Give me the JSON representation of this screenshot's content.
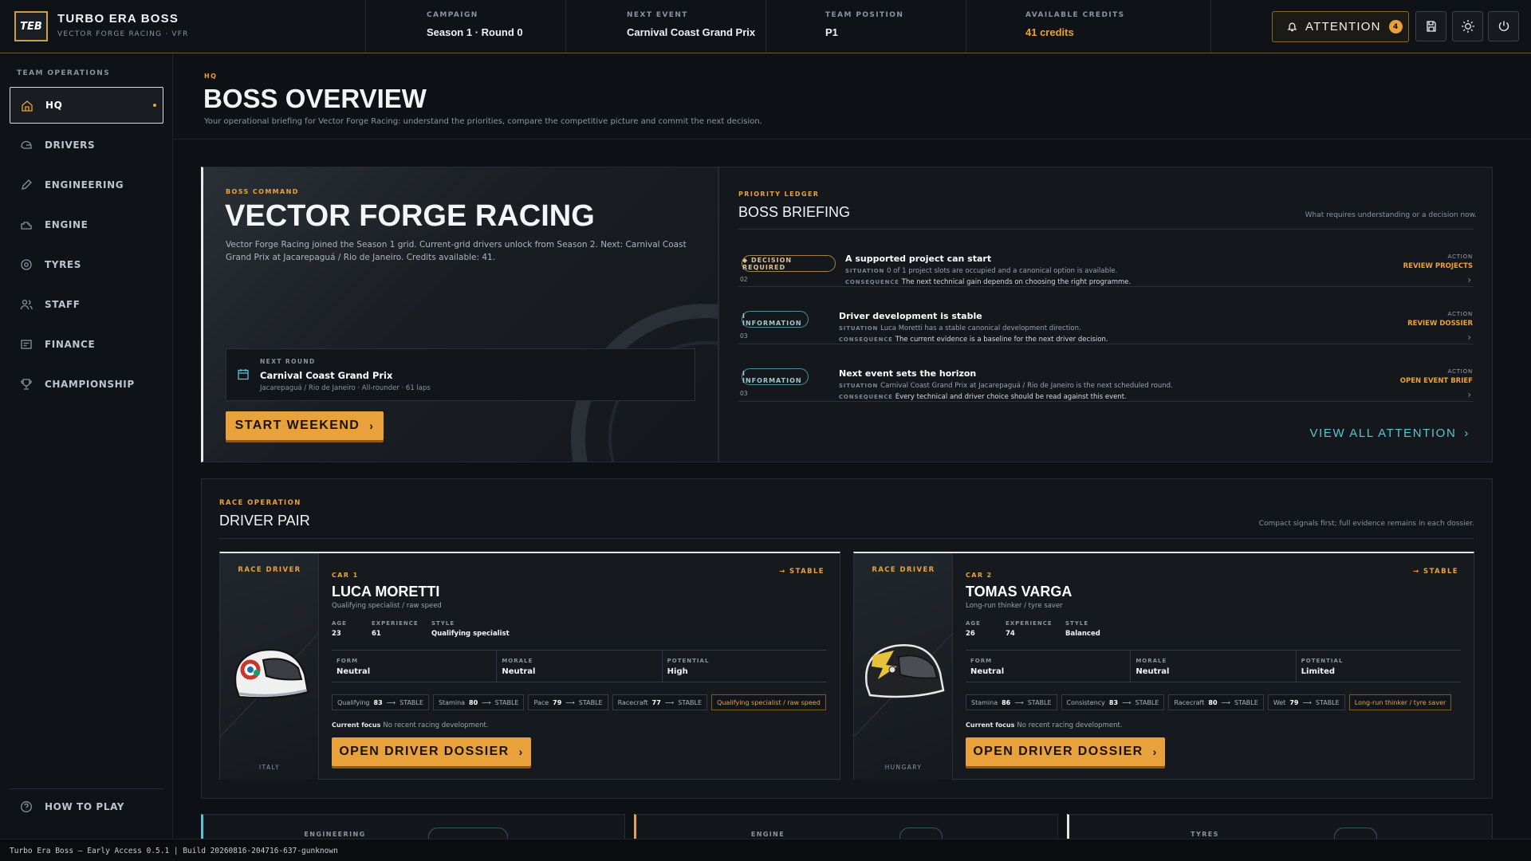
{
  "app": {
    "logo": "TEB",
    "title": "TURBO ERA BOSS",
    "subtitle": "VECTOR FORGE RACING · VFR"
  },
  "header": {
    "stats": [
      {
        "label": "CAMPAIGN",
        "value": "Season 1 · Round 0"
      },
      {
        "label": "NEXT EVENT",
        "value": "Carnival Coast Grand Prix"
      },
      {
        "label": "TEAM POSITION",
        "value": "P1"
      },
      {
        "label": "AVAILABLE CREDITS",
        "value": "41 credits"
      }
    ],
    "attention_label": "ATTENTION",
    "attention_count": "4"
  },
  "sidebar": {
    "section": "TEAM OPERATIONS",
    "items": [
      {
        "label": "HQ"
      },
      {
        "label": "DRIVERS"
      },
      {
        "label": "ENGINEERING"
      },
      {
        "label": "ENGINE"
      },
      {
        "label": "TYRES"
      },
      {
        "label": "STAFF"
      },
      {
        "label": "FINANCE"
      },
      {
        "label": "CHAMPIONSHIP"
      }
    ],
    "help": "HOW TO PLAY"
  },
  "page": {
    "kicker": "HQ",
    "title": "BOSS OVERVIEW",
    "subtitle": "Your operational briefing for Vector Forge Racing: understand the priorities, compare the competitive picture and commit the next decision."
  },
  "command": {
    "kicker": "BOSS COMMAND",
    "title": "VECTOR FORGE RACING",
    "desc": "Vector Forge Racing joined the Season 1 grid. Current-grid drivers unlock from Season 2. Next: Carnival Coast Grand Prix at Jacarepaguá / Rio de Janeiro. Credits available: 41.",
    "next_label": "NEXT ROUND",
    "next_title": "Carnival Coast Grand Prix",
    "next_sub": "Jacarepaguá / Rio de Janeiro · All-rounder · 61 laps",
    "start": "START WEEKEND"
  },
  "briefing": {
    "kicker": "PRIORITY LEDGER",
    "title": "BOSS BRIEFING",
    "note": "What requires understanding or a decision now.",
    "situation_label": "SITUATION",
    "consequence_label": "CONSEQUENCE",
    "action_label": "ACTION",
    "view_all": "VIEW ALL ATTENTION",
    "items": [
      {
        "tag": "◆ DECISION REQUIRED",
        "num": "02",
        "title": "A supported project can start",
        "situation": "0 of 1 project slots are occupied and a canonical option is available.",
        "consequence": "The next technical gain depends on choosing the right programme.",
        "action": "REVIEW PROJECTS"
      },
      {
        "tag": "I INFORMATION",
        "num": "03",
        "title": "Driver development is stable",
        "situation": "Luca Moretti has a stable canonical development direction.",
        "consequence": "The current evidence is a baseline for the next driver decision.",
        "action": "REVIEW DOSSIER"
      },
      {
        "tag": "I INFORMATION",
        "num": "03",
        "title": "Next event sets the horizon",
        "situation": "Carnival Coast Grand Prix at Jacarepaguá / Rio de Janeiro is the next scheduled round.",
        "consequence": "Every technical and driver choice should be read against this event.",
        "action": "OPEN EVENT BRIEF"
      }
    ]
  },
  "race": {
    "kicker": "RACE OPERATION",
    "title": "DRIVER PAIR",
    "note": "Compact signals first; full evidence remains in each dossier.",
    "age_label": "AGE",
    "exp_label": "EXPERIENCE",
    "style_label": "STYLE",
    "form_label": "FORM",
    "morale_label": "MORALE",
    "potential_label": "POTENTIAL",
    "focus_label": "Current focus",
    "dossier": "OPEN DRIVER DOSSIER",
    "role": "RACE DRIVER",
    "drivers": [
      {
        "car": "CAR 1",
        "trend": "→ STABLE",
        "name": "LUCA MORETTI",
        "tagline": "Qualifying specialist / raw speed",
        "age": "23",
        "exp": "61",
        "style": "Qualifying specialist",
        "form": "Neutral",
        "morale": "Neutral",
        "potential": "High",
        "country": "ITALY",
        "focus": "No recent racing development.",
        "chips": [
          {
            "k": "Qualifying",
            "v": "83",
            "t": "STABLE"
          },
          {
            "k": "Stamina",
            "v": "80",
            "t": "STABLE"
          },
          {
            "k": "Pace",
            "v": "79",
            "t": "STABLE"
          },
          {
            "k": "Racecraft",
            "v": "77",
            "t": "STABLE"
          }
        ],
        "trait": "Qualifying specialist / raw speed"
      },
      {
        "car": "CAR 2",
        "trend": "→ STABLE",
        "name": "TOMAS VARGA",
        "tagline": "Long-run thinker / tyre saver",
        "age": "26",
        "exp": "74",
        "style": "Balanced",
        "form": "Neutral",
        "morale": "Neutral",
        "potential": "Limited",
        "country": "HUNGARY",
        "focus": "No recent racing development.",
        "chips": [
          {
            "k": "Stamina",
            "v": "86",
            "t": "STABLE"
          },
          {
            "k": "Consistency",
            "v": "83",
            "t": "STABLE"
          },
          {
            "k": "Racecraft",
            "v": "80",
            "t": "STABLE"
          },
          {
            "k": "Wet",
            "v": "79",
            "t": "STABLE"
          }
        ],
        "trait": "Long-run thinker / tyre saver"
      }
    ]
  },
  "bottom": {
    "cards": [
      "ENGINEERING",
      "ENGINE",
      "TYRES"
    ]
  },
  "footer": "Turbo Era Boss — Early Access 0.5.1 | Build 20260816-204716-637-gunknown"
}
